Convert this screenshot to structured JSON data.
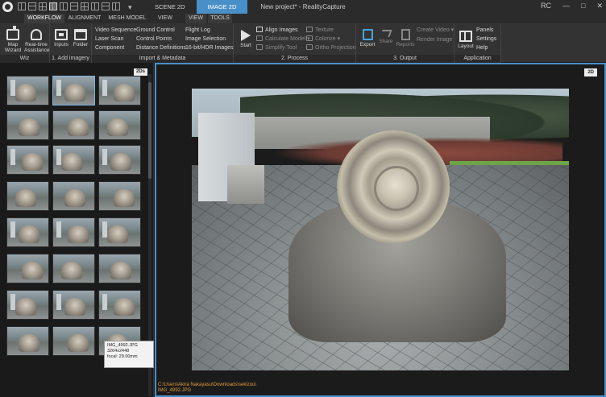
{
  "titlebar": {
    "window_title": "New project* - RealityCapture",
    "view_tabs": [
      "SCENE 2D",
      "IMAGE 2D"
    ],
    "user": "RC",
    "controls": [
      "—",
      "□",
      "✕"
    ]
  },
  "ribbon": {
    "tabs": [
      "WORKFLOW",
      "ALIGNMENT",
      "MESH MODEL",
      "VIEW"
    ],
    "context_tabs": [
      "VIEW",
      "TOOLS"
    ]
  },
  "toolbar": {
    "groups": {
      "wiz": "Wiz",
      "add_imagery": "1. Add imagery",
      "import_metadata": "Import & Metadata",
      "process": "2. Process",
      "output": "3. Output",
      "application": "Application"
    },
    "map_wizard": "Map Wizard",
    "realtime_assistance": "Real-time Assistance",
    "inputs": "Inputs",
    "folder": "Folder",
    "video_sequence": "Video Sequence",
    "laser_scan": "Laser Scan",
    "component": "Component",
    "ground_control": "Ground Control",
    "control_points": "Control Points",
    "distance_definitions": "Distance Definitions",
    "flight_log": "Flight Log",
    "image_selection": "Image Selection",
    "hdr_images": "16-bit/HDR Images",
    "start": "Start",
    "align_images": "Align Images",
    "calculate_model": "Calculate Model",
    "simplify_tool": "Simplify Tool",
    "texture": "Texture",
    "colorize": "Colorize",
    "ortho_projection": "Ortho Projection",
    "export": "Export",
    "share": "Share",
    "reports": "Reports",
    "create_video": "Create Video",
    "render_image": "Render Image",
    "layout": "Layout",
    "panels": "Panels",
    "settings": "Settings",
    "help": "Help"
  },
  "left_panel": {
    "badge": "2Ds",
    "tooltip": {
      "filename": "IMG_4992.JPG",
      "resolution": "3264x2448",
      "focal": "focal: 29.00mm"
    }
  },
  "viewer": {
    "badge": "2D",
    "image_path": "C:\\Users\\Akira Nakayasu\\Downloads\\sekizou\\",
    "image_name": "IMG_4992.JPG"
  },
  "colors": {
    "accent": "#4a90c8",
    "path_text": "#e29a3e"
  }
}
